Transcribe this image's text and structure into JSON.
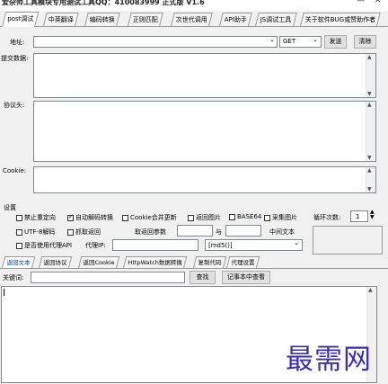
{
  "window": {
    "title": "爱杂师工具模块专用测试工具QQ：410083999 正式版 V1.6",
    "min_glyph": "—",
    "close_glyph": "✕"
  },
  "tabs": [
    {
      "label": "post调试"
    },
    {
      "label": "中英翻译"
    },
    {
      "label": "编码转换"
    },
    {
      "label": "正则匹配"
    },
    {
      "label": "次世代调用"
    },
    {
      "label": "API助手"
    },
    {
      "label": "JS调试工具"
    },
    {
      "label": "关于软件BUG或赞助作者"
    }
  ],
  "request": {
    "address_label": "地址:",
    "address_value": "",
    "method_selected": "GET",
    "send_label": "发送",
    "clear_label": "清除",
    "submit_label": "提交数据:",
    "headers_label": "协议头:",
    "cookie_label": "Cookie:"
  },
  "settings": {
    "section_label": "设置",
    "row1": [
      {
        "label": "禁止重定向",
        "checked": false
      },
      {
        "label": "自动解码转换",
        "checked": true
      },
      {
        "label": "Cookie合并更新",
        "checked": false
      },
      {
        "label": "返回图片",
        "checked": false
      },
      {
        "label": "BASE64",
        "checked": false
      },
      {
        "label": "采集图片",
        "checked": false
      }
    ],
    "loop_label": "循环次数:",
    "loop_value": "1",
    "utf8_label": "UTF-8解码",
    "fetch_label": "抓取返回",
    "take_label": "取返回参数",
    "with_label": "与",
    "middle_text_label": "中间文本",
    "proxy_check_label": "是否使用代理API",
    "proxy_ip_label": "代理IP:",
    "algo_selected": "[md5()]"
  },
  "result_tabs": [
    {
      "label": "返回文本"
    },
    {
      "label": "返回协议"
    },
    {
      "label": "返回Cookie"
    },
    {
      "label": "HttpWatch数据转换"
    },
    {
      "label": "复制代码"
    },
    {
      "label": "代理设置"
    }
  ],
  "search": {
    "keyword_label": "关键词:",
    "find_label": "查找",
    "notepad_label": "记事本中查看"
  },
  "watermark": "最需网"
}
